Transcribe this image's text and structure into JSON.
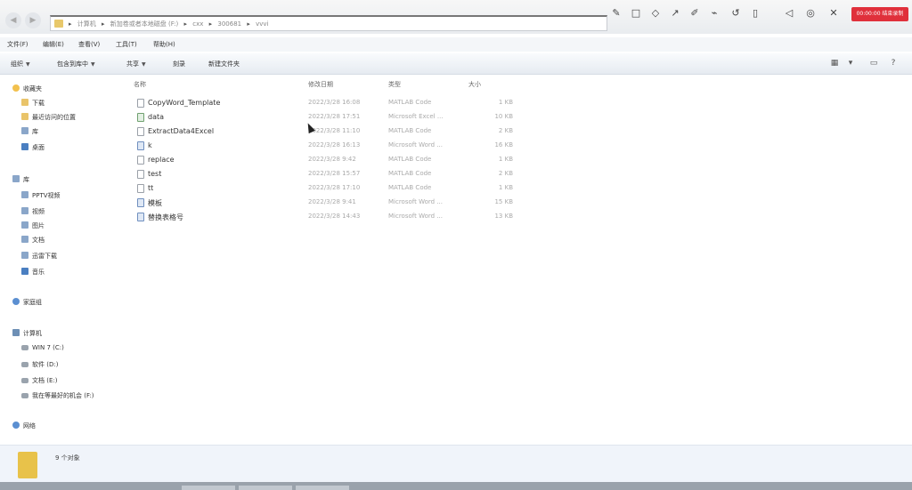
{
  "address_bar": {
    "crumbs": [
      "计算机",
      "新加卷或者本地磁盘 (F:)",
      "cxx",
      "300681",
      "vvvi"
    ]
  },
  "recorder": {
    "tool_icons": [
      "pen-icon",
      "rectangle-icon",
      "shape-icon",
      "arrow-icon",
      "text-pen-icon",
      "highlighter-icon",
      "undo-icon",
      "delete-icon",
      "volume-icon",
      "microphone-icon",
      "close-icon"
    ],
    "record_button_label": "00:00:00 结束录制"
  },
  "menu": {
    "items": [
      "文件(F)",
      "编辑(E)",
      "查看(V)",
      "工具(T)",
      "帮助(H)"
    ]
  },
  "command_bar": {
    "organize": "组织",
    "include_library": "包含到库中",
    "share": "共享",
    "burn": "刻录",
    "new_folder": "新建文件夹"
  },
  "nav_pane": {
    "favorites": {
      "label": "收藏夹",
      "items": [
        "下载",
        "最近访问的位置",
        "库",
        "桌面"
      ]
    },
    "libraries": {
      "label": "库",
      "items": [
        "PPTV视频",
        "视频",
        "图片",
        "文档",
        "迅雷下载",
        "音乐"
      ]
    },
    "homegroup": {
      "label": "家庭组"
    },
    "computer": {
      "label": "计算机",
      "items": [
        "WIN 7 (C:)",
        "软件 (D:)",
        "文档 (E:)",
        "我在等最好的机会 (F:)"
      ]
    },
    "network": {
      "label": "网络"
    }
  },
  "file_list": {
    "columns": {
      "name": "名称",
      "modified": "修改日期",
      "type": "类型",
      "size": "大小"
    },
    "files": [
      {
        "name": "CopyWord_Template",
        "modified": "2022/3/28 16:08",
        "type": "MATLAB Code",
        "size": "1 KB",
        "kind": "code"
      },
      {
        "name": "data",
        "modified": "2022/3/28 17:51",
        "type": "Microsoft Excel ...",
        "size": "10 KB",
        "kind": "excel"
      },
      {
        "name": "ExtractData4Excel",
        "modified": "2022/3/28 11:10",
        "type": "MATLAB Code",
        "size": "2 KB",
        "kind": "code"
      },
      {
        "name": "k",
        "modified": "2022/3/28 16:13",
        "type": "Microsoft Word ...",
        "size": "16 KB",
        "kind": "word"
      },
      {
        "name": "replace",
        "modified": "2022/3/28 9:42",
        "type": "MATLAB Code",
        "size": "1 KB",
        "kind": "code"
      },
      {
        "name": "test",
        "modified": "2022/3/28 15:57",
        "type": "MATLAB Code",
        "size": "2 KB",
        "kind": "code"
      },
      {
        "name": "tt",
        "modified": "2022/3/28 17:10",
        "type": "MATLAB Code",
        "size": "1 KB",
        "kind": "code"
      },
      {
        "name": "模板",
        "modified": "2022/3/28 9:41",
        "type": "Microsoft Word ...",
        "size": "15 KB",
        "kind": "word"
      },
      {
        "name": "替换表格号",
        "modified": "2022/3/28 14:43",
        "type": "Microsoft Word ...",
        "size": "13 KB",
        "kind": "word"
      }
    ]
  },
  "status": {
    "count_label": "9 个对象"
  },
  "colors": {
    "record_red": "#e0303b",
    "folder_yellow": "#e8c24a",
    "details_bg": "#f0f4fa"
  }
}
